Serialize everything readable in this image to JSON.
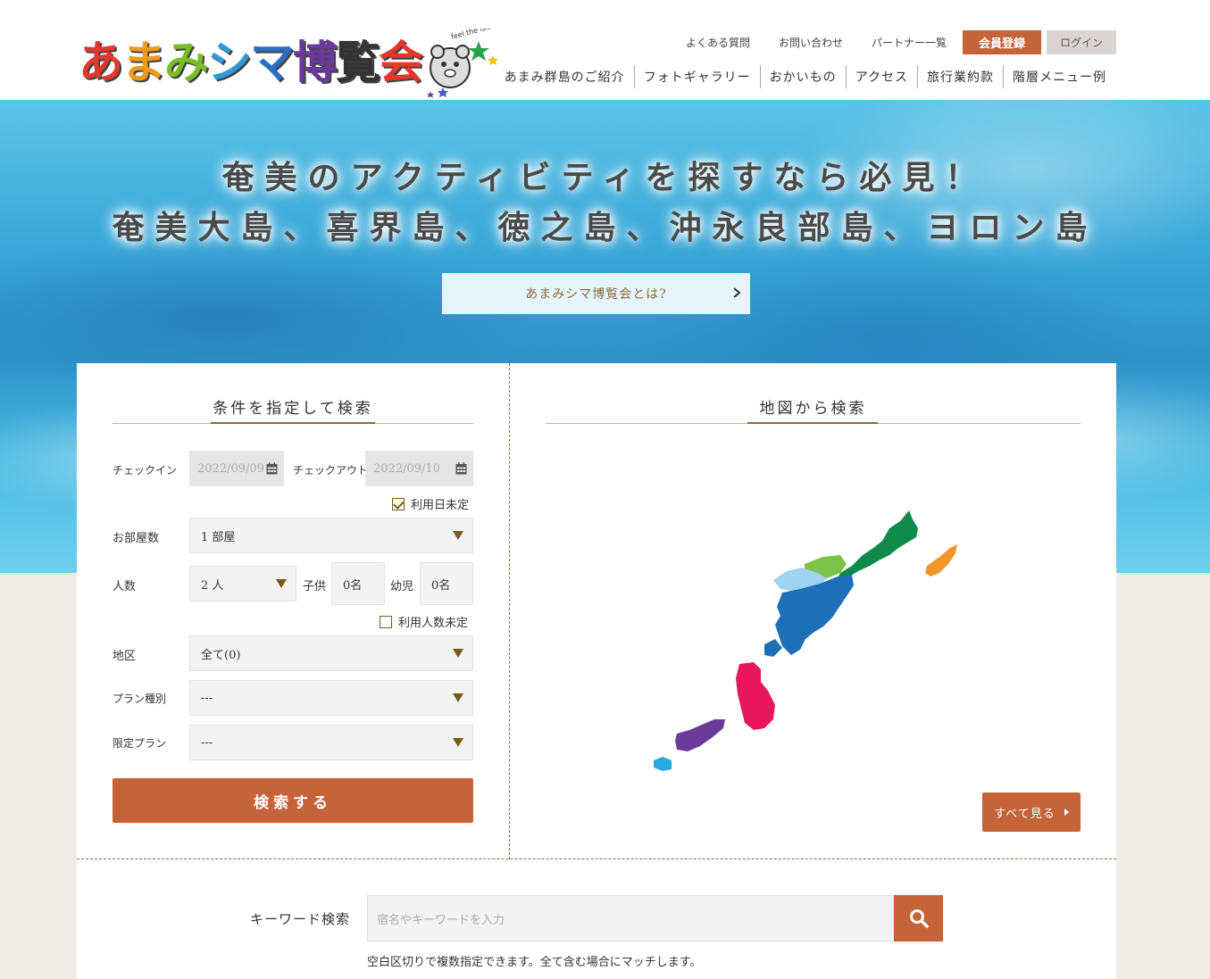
{
  "header": {
    "logo_text": [
      "あ",
      "ま",
      "み",
      "シ",
      "マ",
      "博",
      "覧",
      "会"
    ],
    "logo_tagline": "feel the islands",
    "top_links": [
      "よくある質問",
      "お問い合わせ",
      "パートナー一覧"
    ],
    "register_label": "会員登録",
    "login_label": "ログイン",
    "nav": [
      "あまみ群島のご紹介",
      "フォトギャラリー",
      "おかいもの",
      "アクセス",
      "旅行業約款",
      "階層メニュー例"
    ]
  },
  "hero": {
    "line1": "奄美のアクティビティを探すなら必見！",
    "line2": "奄美大島、喜界島、徳之島、沖永良部島、ヨロン島",
    "about_button": "あまみシマ博覧会とは?"
  },
  "condition_search": {
    "title": "条件を指定して検索",
    "checkin_label": "チェックイン",
    "checkin_value": "2022/09/09",
    "checkout_label": "チェックアウト",
    "checkout_value": "2022/09/10",
    "date_undecided_label": "利用日未定",
    "rooms_label": "お部屋数",
    "rooms_value": "1 部屋",
    "people_label": "人数",
    "adults_value": "2 人",
    "children_label": "子供",
    "children_value": "0名",
    "infants_label": "幼児",
    "infants_value": "0名",
    "people_undecided_label": "利用人数未定",
    "area_label": "地区",
    "area_value": "全て(0)",
    "plan_type_label": "プラン種別",
    "plan_type_value": "---",
    "limited_plan_label": "限定プラン",
    "limited_plan_value": "---",
    "search_button": "検索する"
  },
  "map_search": {
    "title": "地図から検索",
    "see_all_button": "すべて見る",
    "colors": {
      "amami_north": "#0f8a4a",
      "amami_light": "#7dc24a",
      "amami_sky": "#9fd3ef",
      "amami_blue": "#1d6fb8",
      "kikai": "#f2962a",
      "tokunoshima": "#e8175d",
      "okinoerabu": "#6a3a9a",
      "yoron": "#2aa9e0"
    }
  },
  "keyword_search": {
    "label": "キーワード検索",
    "placeholder": "宿名やキーワードを入力",
    "note": "空白区切りで複数指定できます。全て含む場合にマッチします。"
  },
  "colors": {
    "accent": "#c56339",
    "gold": "#8a6a3a",
    "login_bg": "#dad5d2"
  }
}
